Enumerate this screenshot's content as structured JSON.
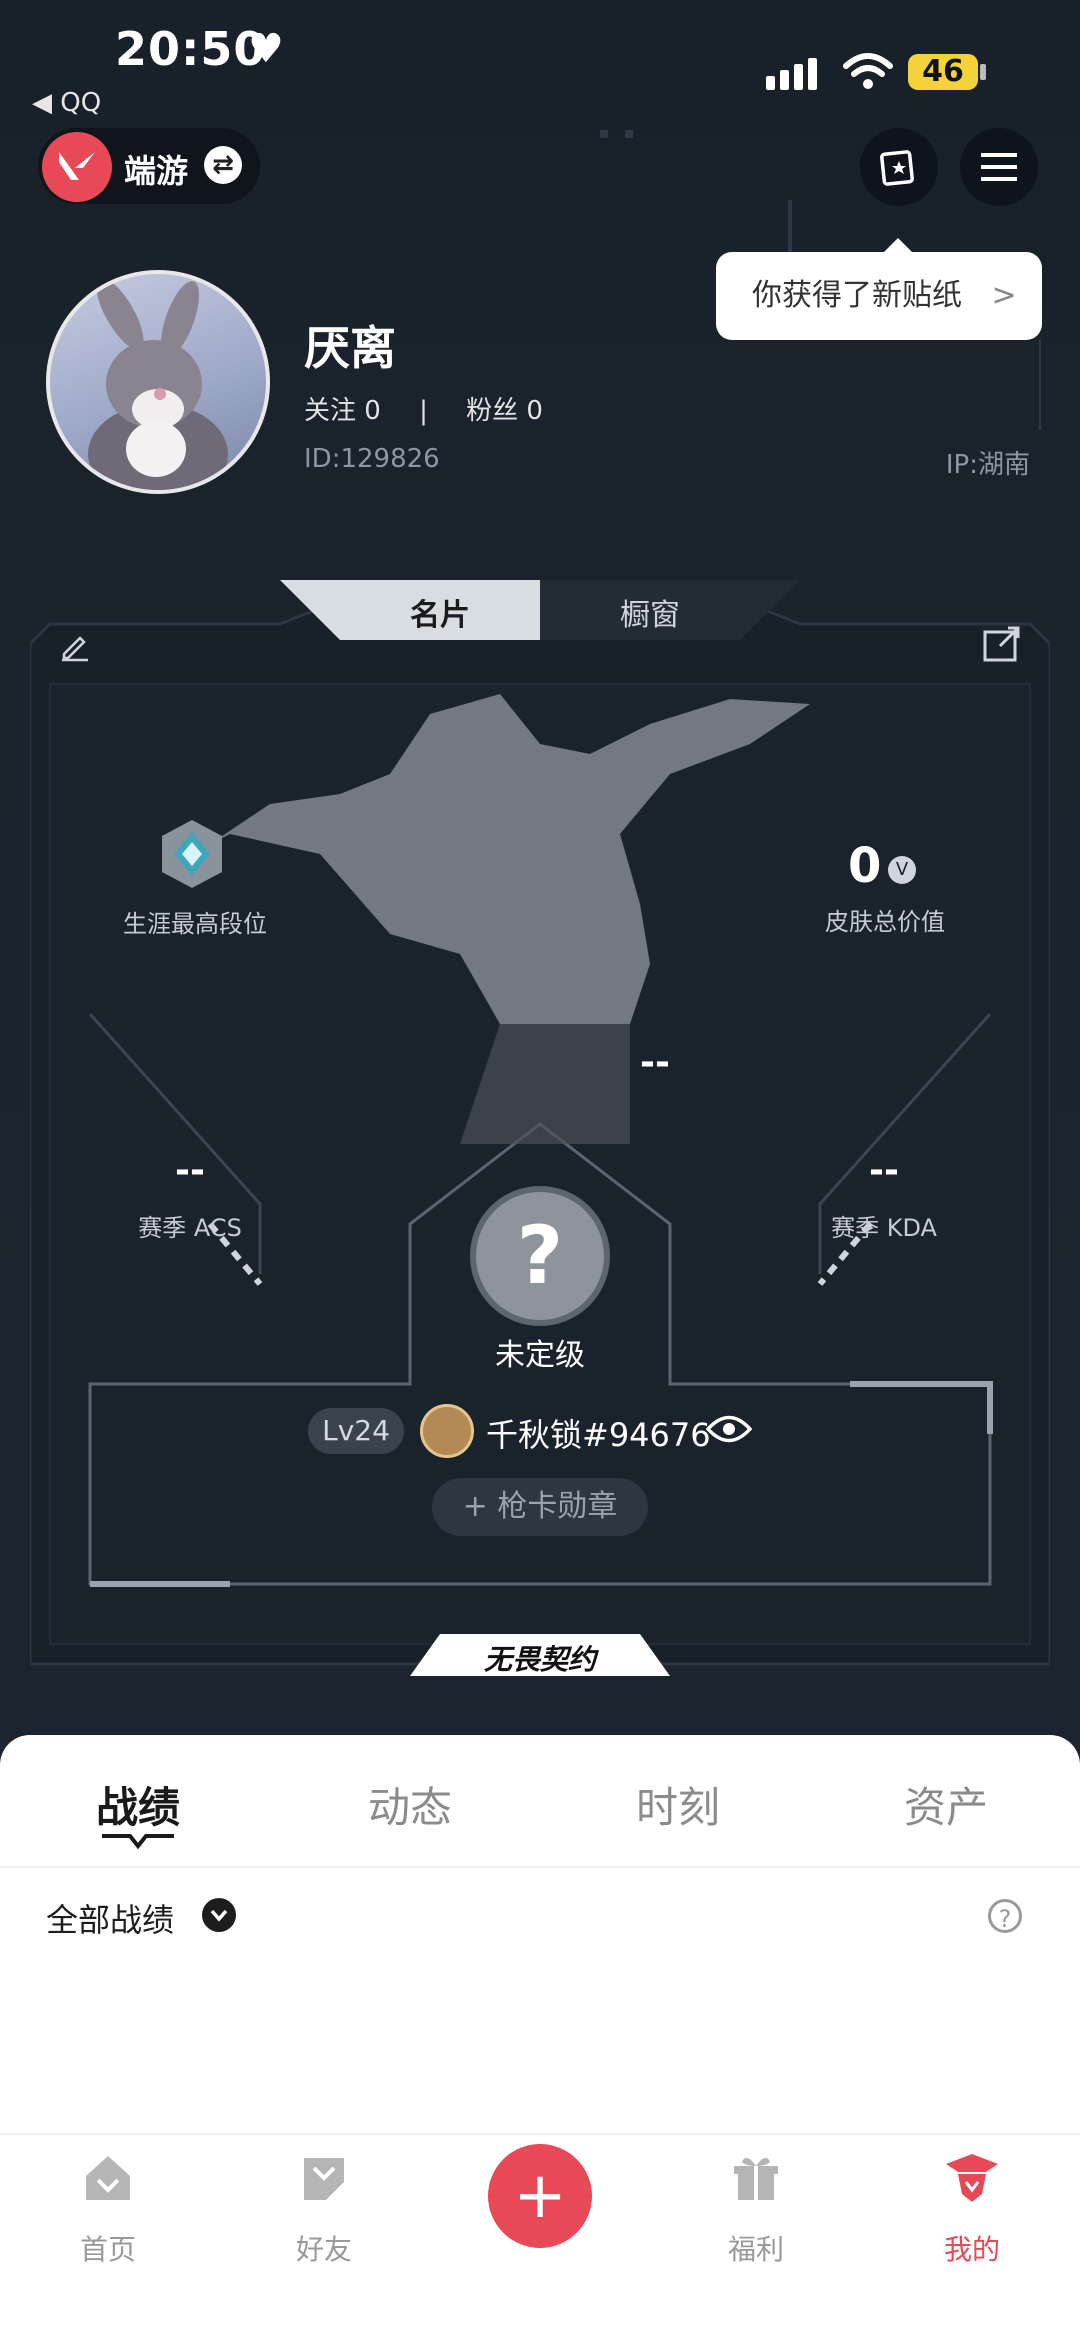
{
  "status_bar": {
    "time": "20:50",
    "back_app": "QQ",
    "battery": "46"
  },
  "header": {
    "game_name": "端游"
  },
  "tooltip": {
    "text": "你获得了新贴纸",
    "arrow": ">"
  },
  "profile": {
    "nickname": "厌离",
    "following": "关注 0",
    "divider": "|",
    "followers": "粉丝 0",
    "id": "ID:129826",
    "ip": "IP:湖南"
  },
  "card": {
    "tabs": [
      "名片",
      "橱窗"
    ],
    "active_tab": 0,
    "career_rank_label": "生涯最高段位",
    "skin_value": "0",
    "skin_value_label": "皮肤总价值",
    "center_dash": "--",
    "acs_value": "--",
    "acs_label": "赛季 ACS",
    "kda_value": "--",
    "kda_label": "赛季 KDA",
    "rank_question": "?",
    "rank_label": "未定级",
    "level": "Lv24",
    "player_tag": "千秋锁#94676",
    "badge_button": "枪卡勋章",
    "brand": "无畏契约"
  },
  "sheet": {
    "tabs": [
      "战绩",
      "动态",
      "时刻",
      "资产"
    ],
    "active_tab": 0,
    "filter_label": "全部战绩",
    "help": "?"
  },
  "nav": {
    "items": [
      {
        "label": "首页",
        "icon": "home-icon"
      },
      {
        "label": "好友",
        "icon": "friends-icon"
      },
      {
        "label": "",
        "icon": "plus-icon"
      },
      {
        "label": "福利",
        "icon": "gift-icon"
      },
      {
        "label": "我的",
        "icon": "profile-icon"
      }
    ],
    "active": 4,
    "accent": "#e84957"
  }
}
